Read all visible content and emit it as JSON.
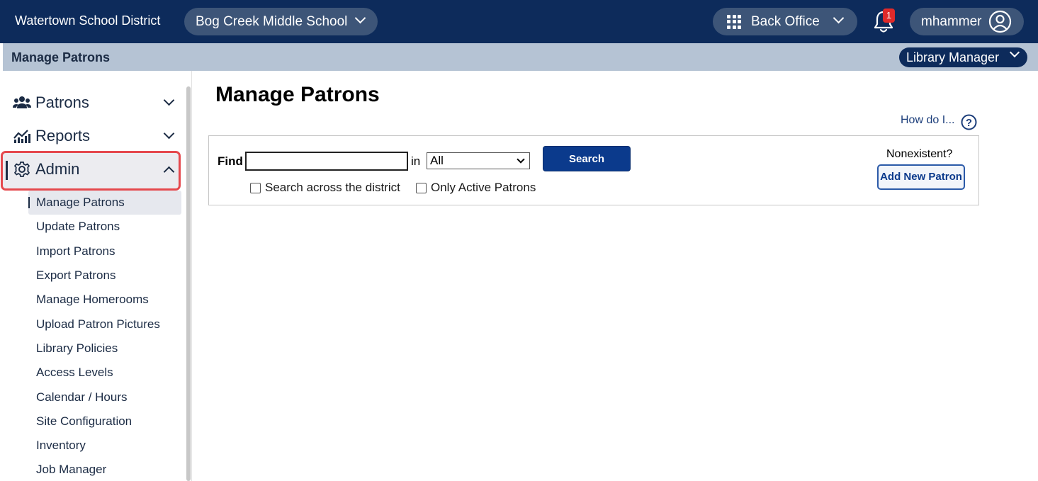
{
  "topbar": {
    "district": "Watertown School District",
    "school": "Bog Creek Middle School",
    "app_switcher": "Back Office",
    "notifications_count": "1",
    "username": "mhammer"
  },
  "subbar": {
    "title": "Manage Patrons",
    "role": "Library Manager"
  },
  "sidebar": {
    "sections": [
      {
        "label": "Patrons",
        "icon": "users-icon",
        "expanded": false
      },
      {
        "label": "Reports",
        "icon": "chart-icon",
        "expanded": false
      },
      {
        "label": "Admin",
        "icon": "gear-icon",
        "expanded": true
      }
    ],
    "admin_items": [
      "Manage Patrons",
      "Update Patrons",
      "Import Patrons",
      "Export Patrons",
      "Manage Homerooms",
      "Upload Patron Pictures",
      "Library Policies",
      "Access Levels",
      "Calendar / Hours",
      "Site Configuration",
      "Inventory",
      "Job Manager"
    ],
    "active_item": "Manage Patrons"
  },
  "main": {
    "title": "Manage Patrons",
    "help_link": "How do I...",
    "find_label": "Find",
    "find_value": "",
    "in_label": "in",
    "scope_selected": "All",
    "search_button": "Search",
    "checkbox_district": "Search across the district",
    "checkbox_active": "Only Active Patrons",
    "nonexistent_label": "Nonexistent?",
    "add_button": "Add New Patron"
  },
  "colors": {
    "navy": "#0d2b5b",
    "pill": "#3d5578",
    "subbar": "#b5c3d4",
    "highlight_border": "#e5484d",
    "button_blue": "#0b3a8c",
    "badge_red": "#e02a2a"
  }
}
